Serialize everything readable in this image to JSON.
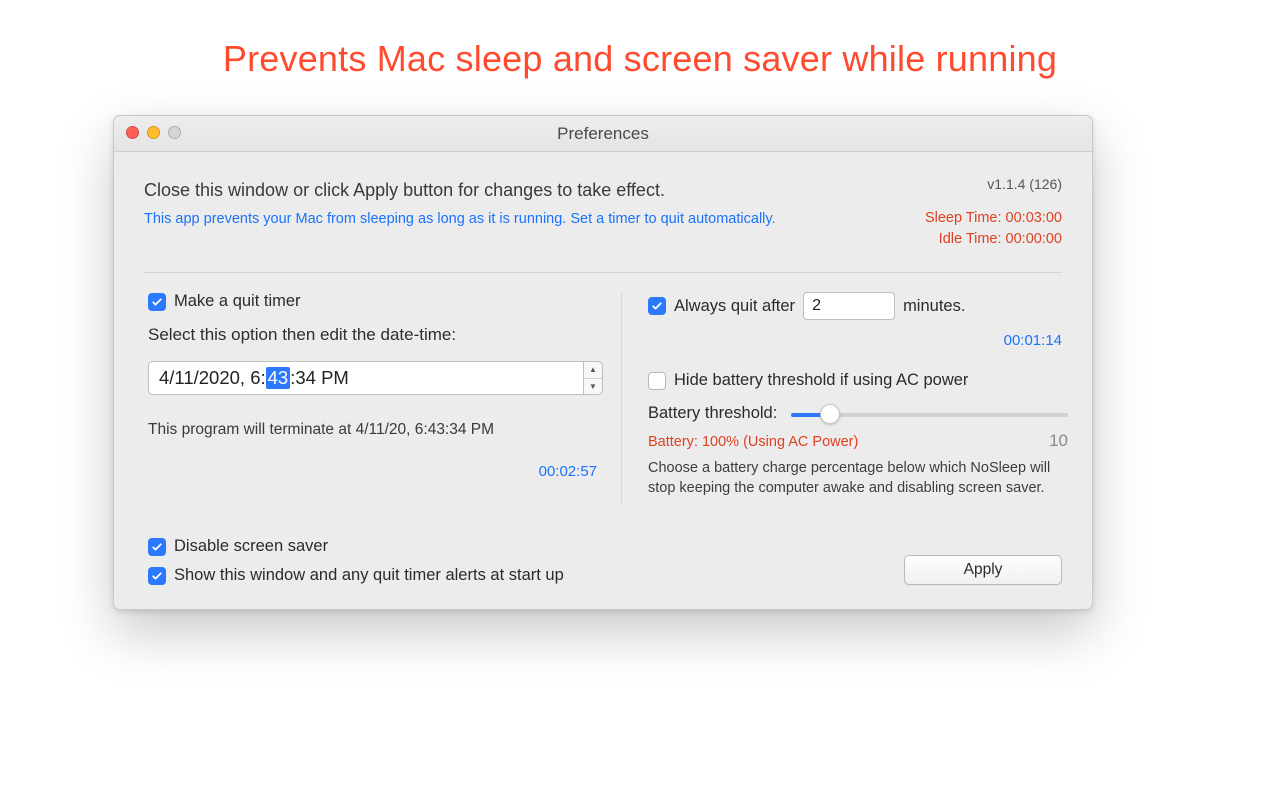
{
  "headline": "Prevents Mac sleep and screen saver while running",
  "window": {
    "title": "Preferences",
    "instruction": "Close this window or click Apply button for changes to take effect.",
    "subinfo": "This app prevents your Mac from sleeping as long as it is running. Set a timer to quit automatically.",
    "version": "v1.1.4 (126)",
    "sleep_time": "Sleep Time: 00:03:00",
    "idle_time": "Idle Time: 00:00:00"
  },
  "left": {
    "make_quit_timer_label": "Make a quit timer",
    "select_hint": "Select this option then edit the date-time:",
    "dt_prefix": "4/11/2020,   6:",
    "dt_selected": "43",
    "dt_suffix": ":34 PM",
    "terminate_line": "This program will terminate at 4/11/20, 6:43:34 PM",
    "countdown": "00:02:57"
  },
  "right": {
    "always_quit_label": "Always quit after",
    "minutes_value": "2",
    "minutes_suffix": "minutes.",
    "countdown": "00:01:14",
    "hide_batt_label": "Hide battery threshold if using AC power",
    "batt_threshold_label": "Battery threshold:",
    "batt_status": "Battery: 100% (Using AC Power)",
    "batt_value": "10",
    "batt_desc": "Choose a battery charge percentage below which NoSleep will stop keeping the computer awake and disabling screen saver."
  },
  "bottom": {
    "disable_ss_label": "Disable screen saver",
    "show_window_label": "Show this window and any quit timer alerts at start up",
    "apply_label": "Apply"
  }
}
